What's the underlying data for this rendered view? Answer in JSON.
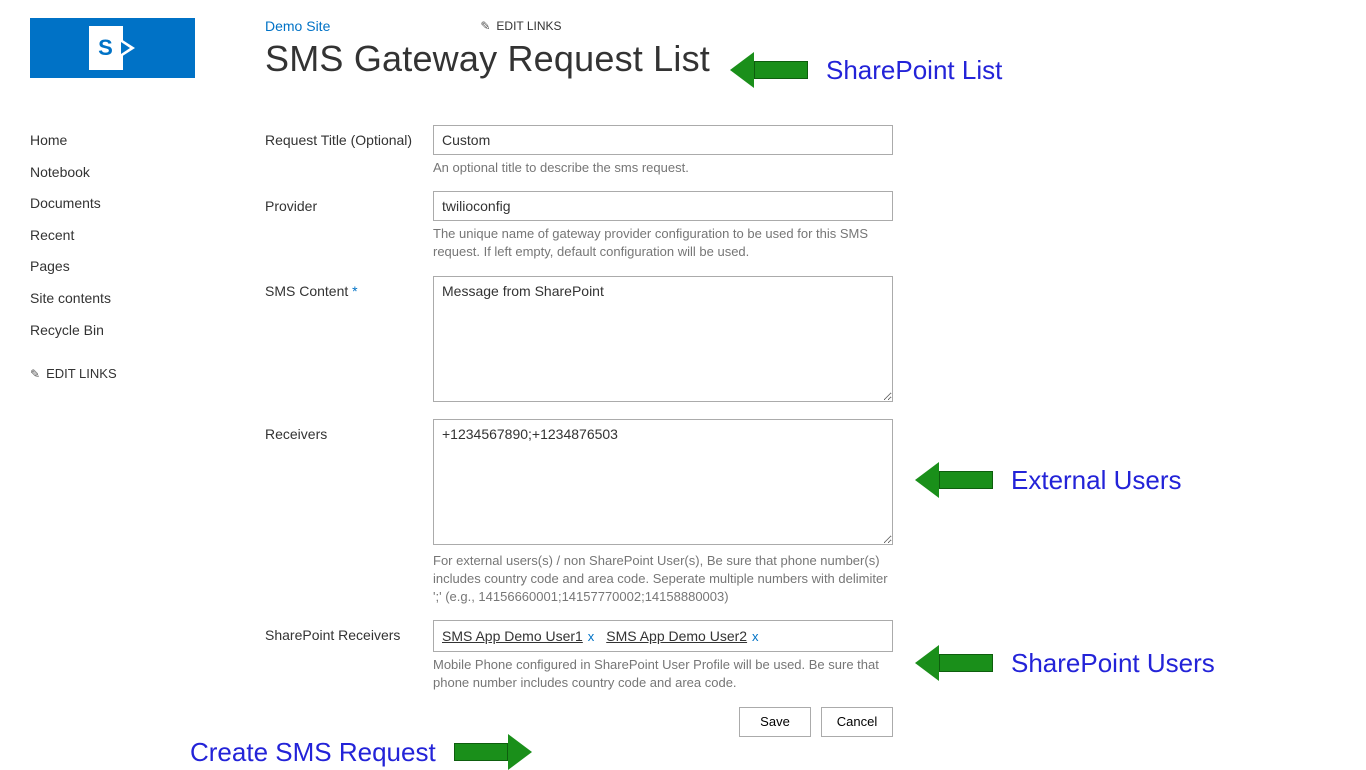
{
  "header": {
    "site_link": "Demo Site",
    "edit_links_label": "EDIT LINKS",
    "page_title": "SMS Gateway Request List"
  },
  "sidebar": {
    "items": [
      "Home",
      "Notebook",
      "Documents",
      "Recent",
      "Pages",
      "Site contents",
      "Recycle Bin"
    ],
    "edit_links_label": "EDIT LINKS"
  },
  "form": {
    "request_title": {
      "label": "Request Title (Optional)",
      "value": "Custom",
      "help": "An optional title to describe the sms request."
    },
    "provider": {
      "label": "Provider",
      "value": "twilioconfig",
      "help": "The unique name of gateway provider configuration to be used for this SMS request. If left empty, default configuration will be used."
    },
    "sms_content": {
      "label": "SMS Content",
      "required_marker": "*",
      "value": "Message from SharePoint"
    },
    "receivers": {
      "label": "Receivers",
      "value": "+1234567890;+1234876503",
      "help": "For external users(s) / non SharePoint User(s), Be sure that phone number(s) includes country code and area code. Seperate multiple numbers with delimiter ';' (e.g., 14156660001;14157770002;14158880003)"
    },
    "sp_receivers": {
      "label": "SharePoint Receivers",
      "chips": [
        {
          "name": "SMS App Demo User1"
        },
        {
          "name": "SMS App Demo User2"
        }
      ],
      "remove_label": "x",
      "help": "Mobile Phone configured in SharePoint User Profile will be used. Be sure that phone number includes country code and area code."
    },
    "buttons": {
      "save": "Save",
      "cancel": "Cancel"
    }
  },
  "annotations": {
    "sharepoint_list": "SharePoint List",
    "external_users": "External Users",
    "sharepoint_users": "SharePoint Users",
    "create_request": "Create SMS Request"
  }
}
